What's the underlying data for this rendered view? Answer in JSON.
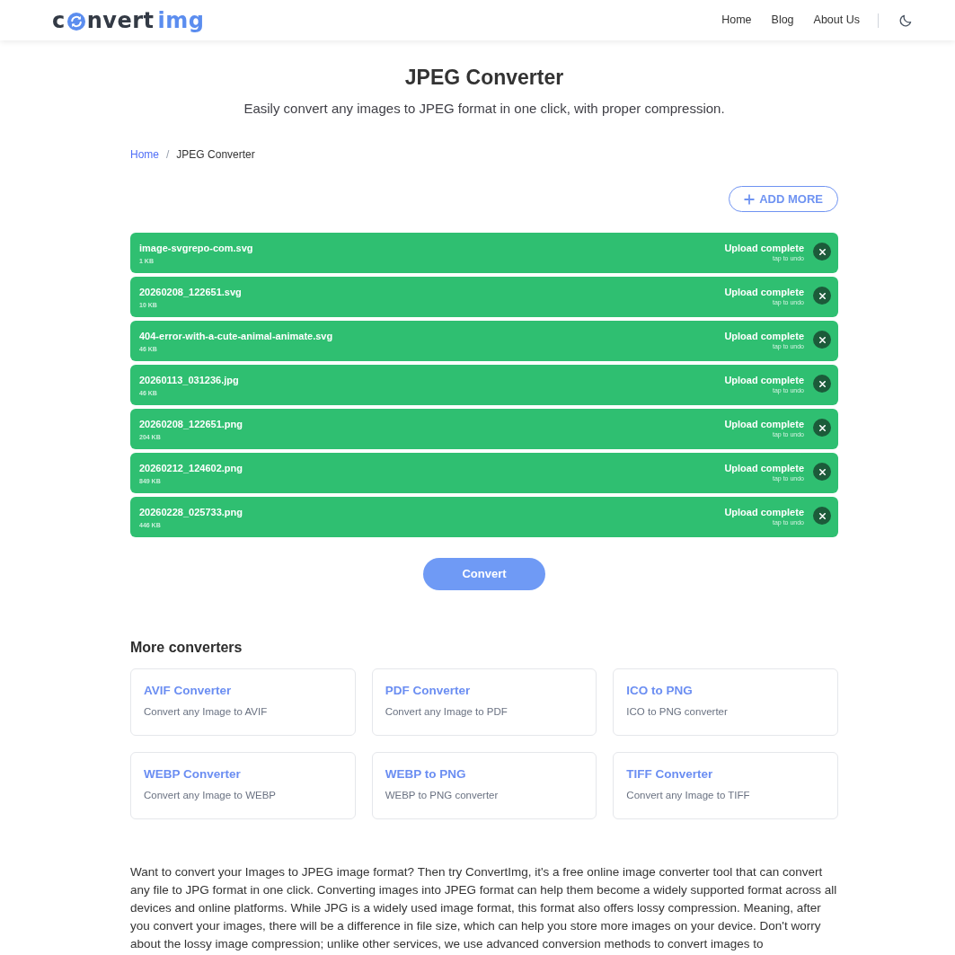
{
  "header": {
    "logo": {
      "lead": "c",
      "tail": "nvert",
      "accent": "img"
    },
    "nav": [
      {
        "label": "Home"
      },
      {
        "label": "Blog"
      },
      {
        "label": "About Us"
      }
    ]
  },
  "page": {
    "title": "JPEG Converter",
    "subtitle": "Easily convert any images to JPEG format in one click, with proper compression."
  },
  "breadcrumb": {
    "separator": "/",
    "items": [
      {
        "label": "Home",
        "kind": "link"
      },
      {
        "label": "JPEG Converter",
        "kind": "current"
      }
    ]
  },
  "uploader": {
    "add_button": "ADD MORE",
    "files": [
      {
        "name": "image-svgrepo-com.svg",
        "size": "1 KB",
        "status": "Upload complete",
        "hint": "tap to undo"
      },
      {
        "name": "20260208_122651.svg",
        "size": "10 KB",
        "status": "Upload complete",
        "hint": "tap to undo"
      },
      {
        "name": "404-error-with-a-cute-animal-animate.svg",
        "size": "46 KB",
        "status": "Upload complete",
        "hint": "tap to undo"
      },
      {
        "name": "20260113_031236.jpg",
        "size": "46 KB",
        "status": "Upload complete",
        "hint": "tap to undo"
      },
      {
        "name": "20260208_122651.png",
        "size": "204 KB",
        "status": "Upload complete",
        "hint": "tap to undo"
      },
      {
        "name": "20260212_124602.png",
        "size": "849 KB",
        "status": "Upload complete",
        "hint": "tap to undo"
      },
      {
        "name": "20260228_025733.png",
        "size": "446 KB",
        "status": "Upload complete",
        "hint": "tap to undo"
      }
    ],
    "convert_button": "Convert"
  },
  "more_converters": {
    "heading": "More converters",
    "cards": [
      {
        "title": "AVIF Converter",
        "description": "Convert any Image to AVIF"
      },
      {
        "title": "PDF Converter",
        "description": "Convert any Image to PDF"
      },
      {
        "title": "ICO to PNG",
        "description": "ICO to PNG converter"
      },
      {
        "title": "WEBP Converter",
        "description": "Convert any Image to WEBP"
      },
      {
        "title": "WEBP to PNG",
        "description": "WEBP to PNG converter"
      },
      {
        "title": "TIFF Converter",
        "description": "Convert any Image to TIFF"
      }
    ]
  },
  "article": {
    "text": "Want to convert your Images to JPEG image format? Then try ConvertImg, it's a free online image converter tool that can convert any file to JPG format in one click. Converting images into JPEG format can help them become a widely supported format across all devices and online platforms. While JPG is a widely used image format, this format also offers lossy compression. Meaning, after you convert your images, there will be a difference in file size, which can help you store more images on your device. Don't worry about the lossy image compression; unlike other services, we use advanced conversion methods to convert images to"
  }
}
